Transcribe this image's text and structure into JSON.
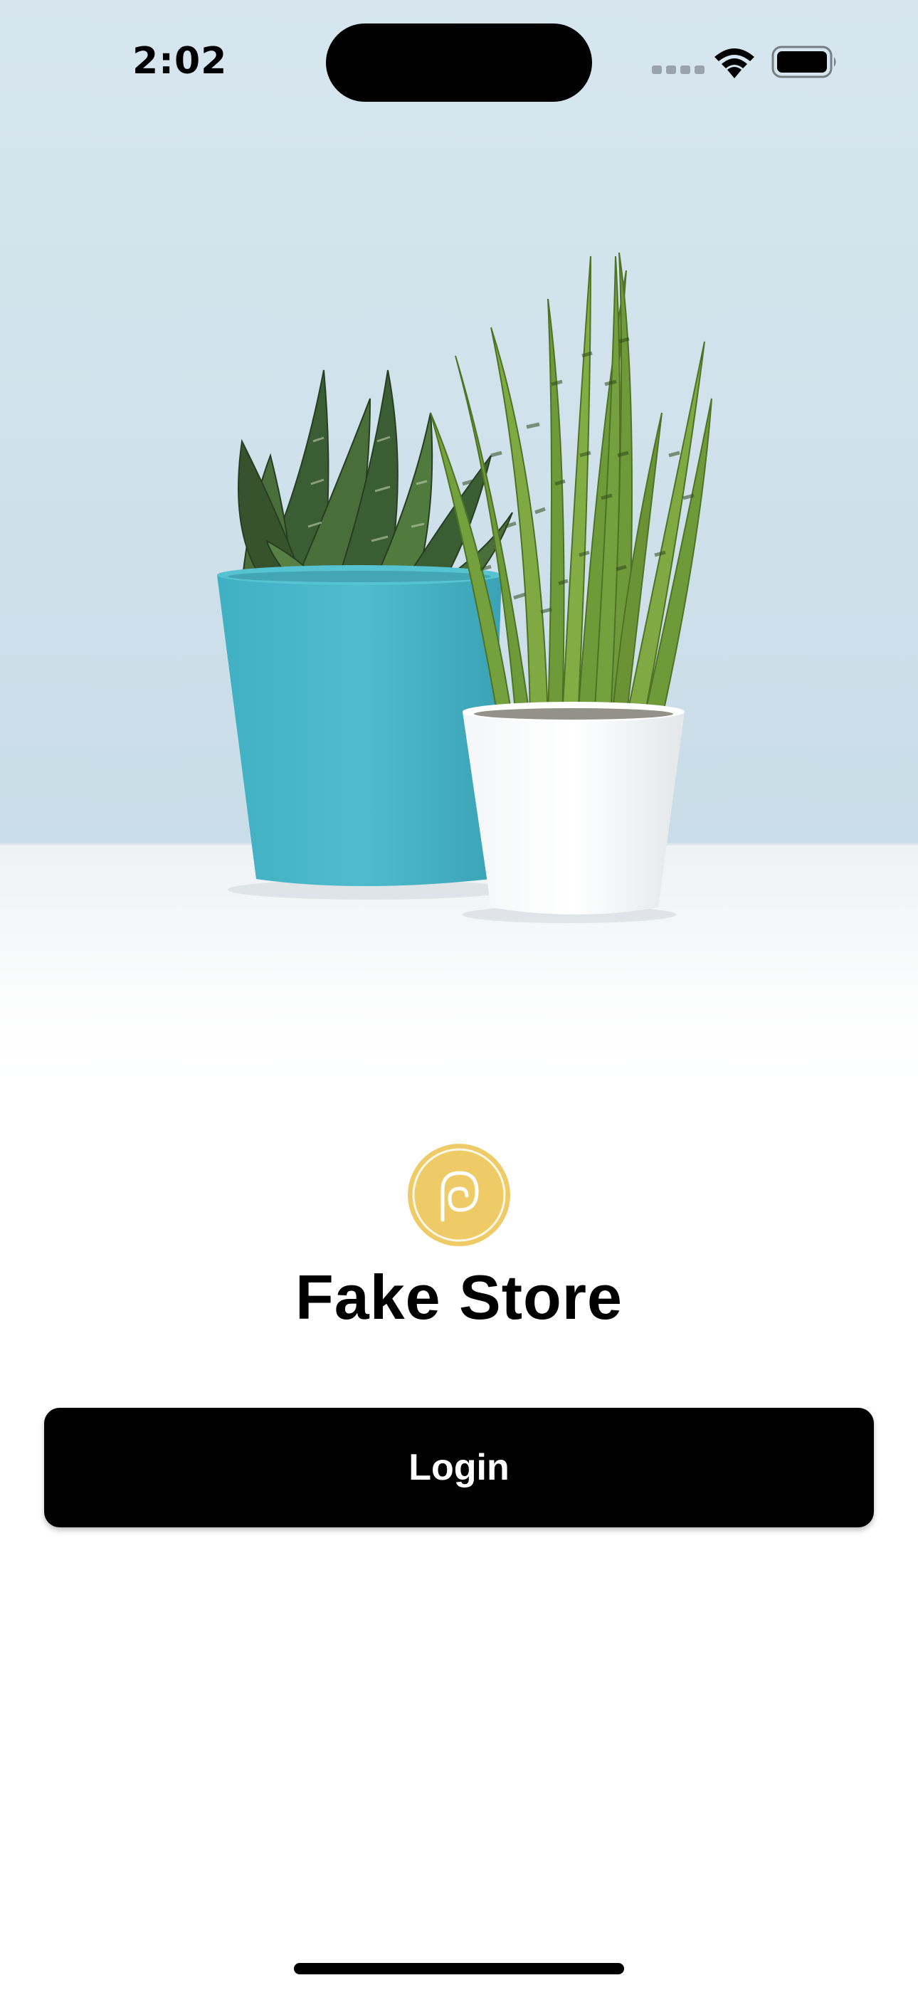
{
  "status_bar": {
    "time": "2:02"
  },
  "brand": {
    "name": "Fake Store",
    "logo_color": "#EFCB68"
  },
  "actions": {
    "login_label": "Login"
  },
  "colors": {
    "wall": "#CFE2EC",
    "button_bg": "#000000",
    "button_text": "#FFFFFF"
  },
  "icons": {
    "wifi": "wifi-icon",
    "battery": "battery-icon",
    "logo": "brand-logo-icon"
  }
}
